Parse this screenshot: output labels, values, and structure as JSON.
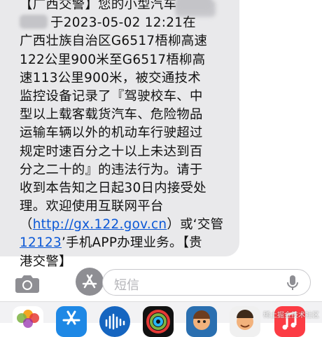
{
  "message": {
    "lines": [
      {
        "segments": [
          {
            "text": "【广西交警】您的小型汽车"
          },
          {
            "redacted": true
          }
        ]
      },
      {
        "segments": [
          {
            "redacted": true
          },
          {
            "text": "于2023-05-02 12:21在"
          }
        ]
      },
      {
        "segments": [
          {
            "text": "广西壮族自治区G6517梧柳高速"
          }
        ]
      },
      {
        "segments": [
          {
            "text": "122公里900米至G6517梧柳高"
          }
        ]
      },
      {
        "segments": [
          {
            "text": "速113公里900米，被交通技术"
          }
        ]
      },
      {
        "segments": [
          {
            "text": "监控设备记录了『驾驶校车、中"
          }
        ]
      },
      {
        "segments": [
          {
            "text": "型以上载客载货汽车、危险物品"
          }
        ]
      },
      {
        "segments": [
          {
            "text": "运输车辆以外的机动车行驶超过"
          }
        ]
      },
      {
        "segments": [
          {
            "text": "规定时速百分之十以上未达到百"
          }
        ]
      },
      {
        "segments": [
          {
            "text": "分之二十的』的违法行为。请于"
          }
        ]
      },
      {
        "segments": [
          {
            "text": "收到本告知之日起30日内接受处"
          }
        ]
      },
      {
        "segments": [
          {
            "text": "理。欢迎使用互联网平台"
          }
        ]
      },
      {
        "segments": [
          {
            "text": "（"
          },
          {
            "text": "http://gx.122.gov.cn",
            "link": true
          },
          {
            "text": "）或‘交管"
          }
        ]
      },
      {
        "segments": [
          {
            "text": "12123",
            "link": true
          },
          {
            "text": "’手机APP办理业务。【贵"
          }
        ]
      },
      {
        "segments": [
          {
            "text": "港交警】"
          }
        ]
      }
    ]
  },
  "composer": {
    "placeholder": "短信",
    "camera_icon": "camera-icon",
    "apps_icon": "app-store-icon",
    "mic_icon": "microphone-icon"
  },
  "app_drawer": {
    "apps": [
      "photos-icon",
      "app-store-icon",
      "audio-message-icon",
      "activity-icon",
      "memoji-icon",
      "memoji-stickers-icon",
      "music-icon"
    ]
  },
  "watermark": "稀土掘金技术社区",
  "colors": {
    "bubble": "#e9e9eb",
    "link": "#0a57d6",
    "text": "#111111",
    "placeholder": "#b4b4b8"
  }
}
